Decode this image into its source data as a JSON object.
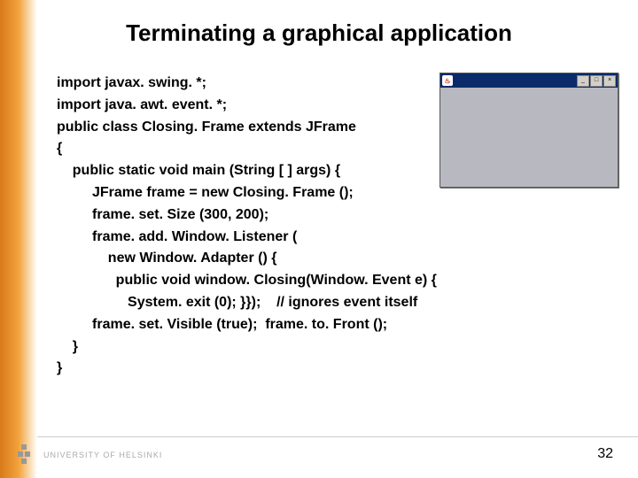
{
  "title": "Terminating a graphical application",
  "code_lines": [
    "import javax. swing. *;",
    "import java. awt. event. *;",
    "public class Closing. Frame extends JFrame",
    "{",
    "    public static void main (String [ ] args) {",
    "         JFrame frame = new Closing. Frame ();",
    "         frame. set. Size (300, 200);",
    "         frame. add. Window. Listener (",
    "             new Window. Adapter () {",
    "               public void window. Closing(Window. Event e) {",
    "                  System. exit (0); }});    // ignores event itself",
    "         frame. set. Visible (true);  frame. to. Front ();",
    "    }",
    "}"
  ],
  "window": {
    "java_icon": "♨",
    "min": "_",
    "max": "□",
    "close": "×"
  },
  "footer": {
    "org": "UNIVERSITY OF HELSINKI"
  },
  "page_number": "32"
}
